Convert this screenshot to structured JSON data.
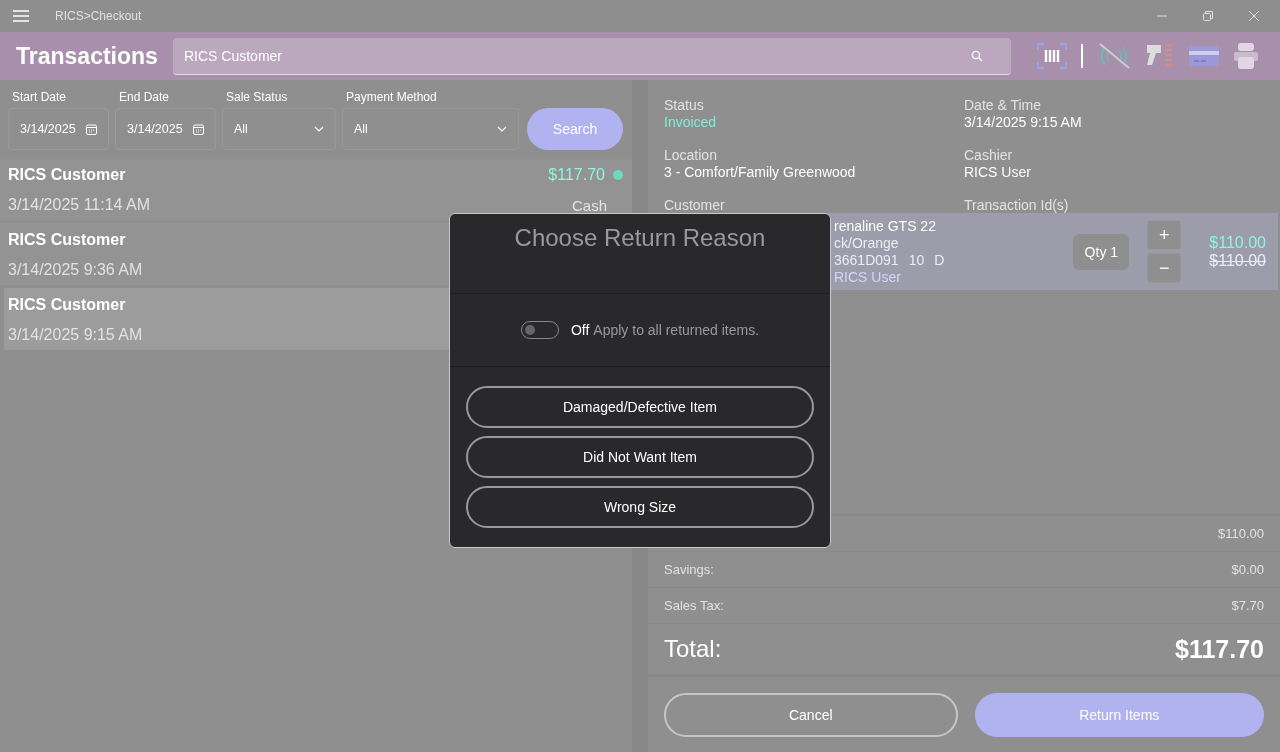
{
  "window": {
    "title": "RICS>Checkout"
  },
  "header": {
    "title": "Transactions",
    "search": {
      "value": "RICS Customer"
    }
  },
  "filters": [
    {
      "kind": "date",
      "label": "Start Date",
      "value": "3/14/2025"
    },
    {
      "kind": "date",
      "label": "End Date",
      "value": "3/14/2025"
    },
    {
      "kind": "select",
      "label": "Sale Status",
      "value": "All"
    },
    {
      "kind": "select",
      "label": "Payment Method",
      "value": "All"
    }
  ],
  "search_button": "Search",
  "transactions": [
    {
      "customer": "RICS Customer",
      "datetime": "3/14/2025 11:14 AM",
      "amount": "$117.70",
      "color": "#6fd8c0",
      "payment": "Cash",
      "selected": false
    },
    {
      "customer": "RICS Customer",
      "datetime": "3/14/2025 9:36 AM",
      "selected": false
    },
    {
      "customer": "RICS Customer",
      "datetime": "3/14/2025 9:15 AM",
      "selected": true
    }
  ],
  "details": [
    {
      "kind": "status",
      "label": "Status",
      "value": "Invoiced"
    },
    {
      "kind": "text",
      "label": "Date & Time",
      "value": "3/14/2025 9:15 AM"
    },
    {
      "kind": "text",
      "label": "Location",
      "value": "3 - Comfort/Family Greenwood"
    },
    {
      "kind": "text",
      "label": "Cashier",
      "value": "RICS User"
    },
    {
      "kind": "text",
      "label": "Customer"
    },
    {
      "kind": "text",
      "label": "Transaction Id(s)"
    }
  ],
  "line_item": {
    "name": "renaline GTS 22",
    "variant": "ck/Orange",
    "sku": "3661D091",
    "size": "10",
    "width": "D",
    "salesperson": "RICS User",
    "qty": "Qty 1",
    "increase": "+",
    "decrease": "−",
    "price": "$110.00",
    "original_price": "$110.00"
  },
  "totals": [
    {
      "value": "$110.00"
    },
    {
      "label": "Savings:",
      "value": "$0.00"
    },
    {
      "label": "Sales Tax:",
      "value": "$7.70"
    }
  ],
  "total": {
    "label": "Total:",
    "value": "$117.70"
  },
  "buttons": {
    "cancel": "Cancel",
    "confirm": "Return Items"
  },
  "modal": {
    "title": "Choose Return Reason",
    "toggle": {
      "on": false,
      "state_label": "Off",
      "label": "Apply to all returned items."
    },
    "reasons": [
      "Damaged/Defective Item",
      "Did Not Want Item",
      "Wrong Size"
    ]
  }
}
